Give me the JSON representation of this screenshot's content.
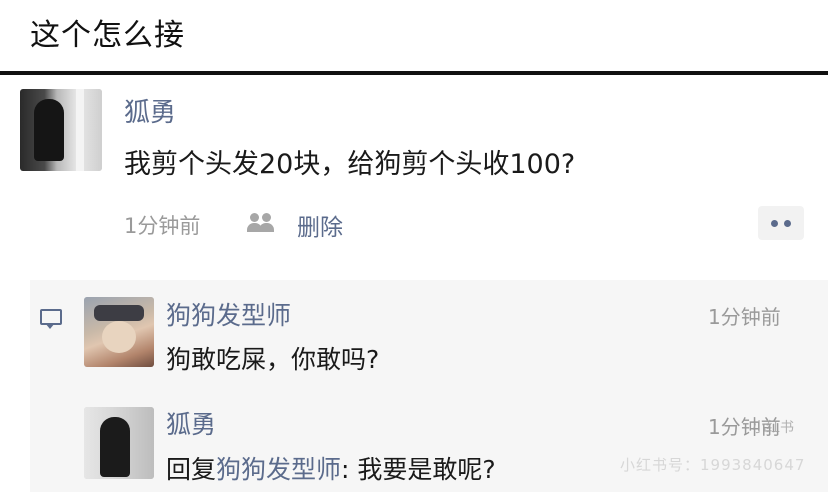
{
  "header": {
    "title": "这个怎么接"
  },
  "post": {
    "author": "狐勇",
    "text": "我剪个头发20块，给狗剪个头收100?",
    "time": "1分钟前",
    "delete_label": "删除",
    "more_icon": "more-dots-icon",
    "privacy_icon": "people-icon"
  },
  "comments": [
    {
      "author": "狗狗发型师",
      "time": "1分钟前",
      "text": "狗敢吃屎，你敢吗?"
    },
    {
      "author": "狐勇",
      "time": "1分钟前",
      "reply_prefix": "回复",
      "reply_to": "狗狗发型师",
      "reply_sep": ": ",
      "text": "我要是敢呢?"
    }
  ],
  "watermark": {
    "logo": "小红书",
    "id": "小红书号：1993840647"
  },
  "colors": {
    "link": "#5b6b8c",
    "meta": "#9a9a9a",
    "panel": "#f6f6f6",
    "divider": "#111111"
  }
}
